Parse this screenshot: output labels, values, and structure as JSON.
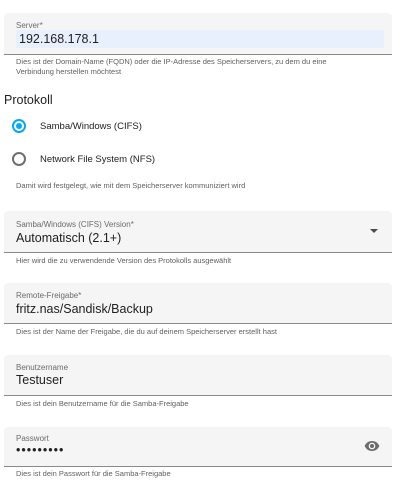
{
  "server": {
    "label": "Server*",
    "value": "192.168.178.1",
    "hint_line1": "Dies ist der Domain-Name (FQDN) oder die IP-Adresse des Speicherservers, zu dem du eine",
    "hint_line2": "Verbindung herstellen möchtest"
  },
  "protocol": {
    "title": "Protokoll",
    "options": [
      {
        "label": "Samba/Windows (CIFS)",
        "checked": true
      },
      {
        "label": "Network File System (NFS)",
        "checked": false
      }
    ],
    "hint": "Damit wird festgelegt, wie mit dem Speicherserver kommuniziert wird"
  },
  "version": {
    "label": "Samba/Windows (CIFS) Version*",
    "value": "Automatisch (2.1+)",
    "hint": "Hier wird die zu verwendende Version des Protokolls ausgewählt",
    "icon": "dropdown-arrow-icon"
  },
  "remote": {
    "label": "Remote-Freigabe*",
    "value": "fritz.nas/Sandisk/Backup",
    "hint": "Dies ist der Name der Freigabe, die du auf deinem Speicherserver erstellt hast"
  },
  "username": {
    "label": "Benutzername",
    "value": "Testuser",
    "hint": "Dies ist dein Benutzername für die Samba-Freigabe"
  },
  "password": {
    "label": "Passwort",
    "value": "•••••••••",
    "hint": "Dies ist dein Passwort für die Samba-Freigabe",
    "icon": "eye-icon"
  },
  "colors": {
    "accent": "#03a9f4",
    "field_bg": "#f5f5f5",
    "autofill_bg": "#e8f0fe"
  }
}
